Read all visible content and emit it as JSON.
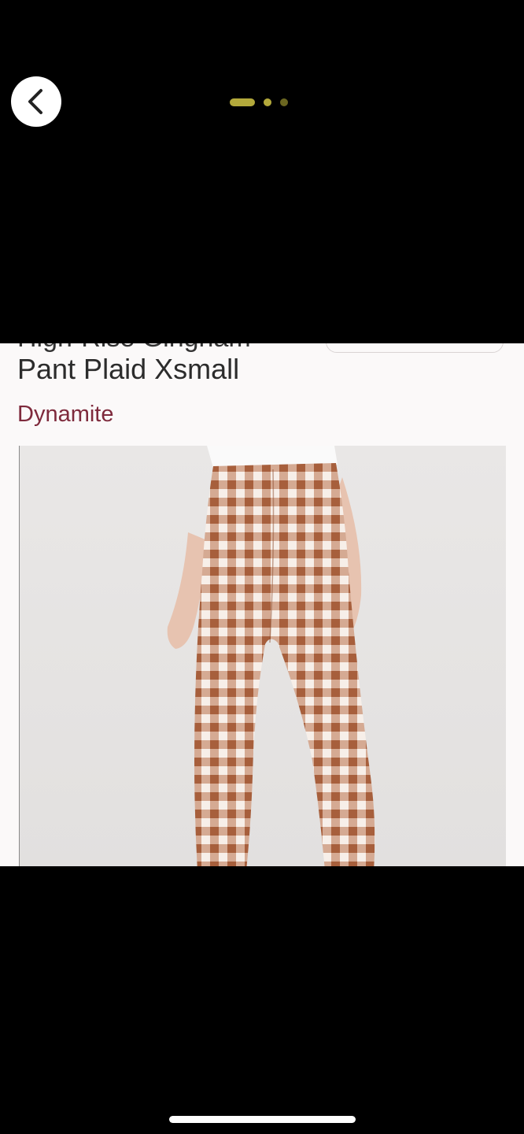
{
  "header": {
    "back_icon": "chevron-left-icon",
    "pager": {
      "total_pages": 3,
      "active_index": 0
    }
  },
  "product": {
    "title_partial_line": "High-Rise Gingham",
    "title_line": "Pant Plaid Xsmall",
    "brand": "Dynamite",
    "photo_description_icon": "product-photo"
  },
  "colors": {
    "background": "#000000",
    "content_background": "#fbf9f9",
    "brand_color": "#7e2a3c",
    "pager_active": "#b3a93b",
    "gingham_brown": "#b06a45"
  }
}
